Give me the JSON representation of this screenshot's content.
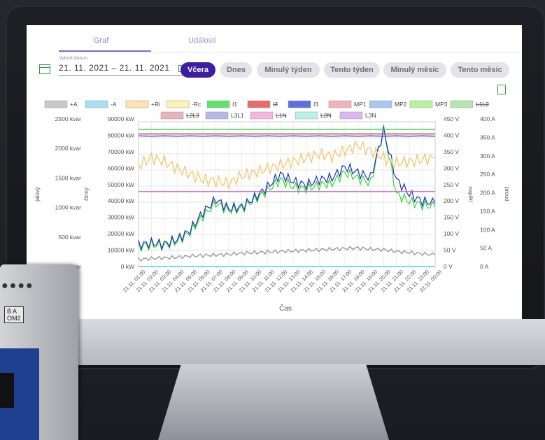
{
  "tabs": [
    {
      "label": "Graf",
      "active": true
    },
    {
      "label": "Události",
      "active": false
    }
  ],
  "date": {
    "label": "Vybrat datum",
    "value": "21. 11. 2021 – 21. 11. 2021"
  },
  "buttons": [
    {
      "label": "Včera",
      "active": true
    },
    {
      "label": "Dnes",
      "active": false
    },
    {
      "label": "Minulý týden",
      "active": false
    },
    {
      "label": "Tento týden",
      "active": false
    },
    {
      "label": "Minulý měsíc",
      "active": false
    },
    {
      "label": "Tento měsíc",
      "active": false
    }
  ],
  "meter": {
    "label_text": "B A",
    "label_sub": "OM2"
  },
  "colors": {
    "accent": "#3b1fa0",
    "tab": "#8a7fd0",
    "green_icon": "#2e9a46"
  },
  "chart_data": {
    "type": "line",
    "xlabel": "Čas",
    "x": [
      "21.11. 01:00",
      "21.11. 02:00",
      "21.11. 03:00",
      "21.11. 04:00",
      "21.11. 05:00",
      "21.11. 06:00",
      "21.11. 07:00",
      "21.11. 08:00",
      "21.11. 09:00",
      "21.11. 10:00",
      "21.11. 11:00",
      "21.11. 12:00",
      "21.11. 13:00",
      "21.11. 14:00",
      "21.11. 15:00",
      "21.11. 16:00",
      "21.11. 17:00",
      "21.11. 18:00",
      "21.11. 19:00",
      "21.11. 20:00",
      "21.11. 21:00",
      "21.11. 22:00",
      "21.11. 23:00",
      "22.11. 00:00"
    ],
    "axes": [
      {
        "label": "jalový",
        "ticks": [
          "0 kvar",
          "500 kvar",
          "1000 kvar",
          "1500 kvar",
          "2000 kvar",
          "2500 kvar"
        ],
        "range": [
          0,
          2500
        ],
        "unit": "kvar"
      },
      {
        "label": "činný",
        "ticks": [
          "0 kW",
          "10000 kW",
          "20000 kW",
          "30000 kW",
          "40000 kW",
          "50000 kW",
          "60000 kW",
          "70000 kW",
          "80000 kW",
          "90000 kW"
        ],
        "range": [
          0,
          90000
        ],
        "unit": "kW"
      },
      {
        "label": "napětí",
        "ticks": [
          "0 V",
          "50 V",
          "100 V",
          "150 V",
          "200 V",
          "250 V",
          "300 V",
          "350 V",
          "400 V",
          "450 V"
        ],
        "range": [
          0,
          450
        ],
        "unit": "V"
      },
      {
        "label": "proud",
        "ticks": [
          "0 A",
          "50 A",
          "100 A",
          "150 A",
          "200 A",
          "250 A",
          "300 A",
          "350 A",
          "400 A"
        ],
        "range": [
          0,
          400
        ],
        "unit": "A"
      }
    ],
    "legend": [
      {
        "name": "+A",
        "color": "#c8c8c8",
        "struck": false
      },
      {
        "name": "-A",
        "color": "#a8dff5",
        "struck": false
      },
      {
        "name": "+Ri",
        "color": "#fde2b0",
        "struck": false
      },
      {
        "name": "-Rc",
        "color": "#fbf3b4",
        "struck": false
      },
      {
        "name": "I1",
        "color": "#5ee36a",
        "struck": false
      },
      {
        "name": "I2",
        "color": "#e86b6b",
        "struck": true
      },
      {
        "name": "I3",
        "color": "#5d6fe0",
        "struck": false
      },
      {
        "name": "MP1",
        "color": "#f4b1b8",
        "struck": false
      },
      {
        "name": "MP2",
        "color": "#a9c7f3",
        "struck": false
      },
      {
        "name": "MP3",
        "color": "#b8f29d",
        "struck": false
      },
      {
        "name": "L1L2",
        "color": "#b6e6b0",
        "struck": true
      },
      {
        "name": "L2L3",
        "color": "#e6b3b8",
        "struck": true
      },
      {
        "name": "L3L1",
        "color": "#b6b8e6",
        "struck": false
      },
      {
        "name": "L1N",
        "color": "#f4b6dc",
        "struck": true
      },
      {
        "name": "L2N",
        "color": "#b8f0ea",
        "struck": true
      },
      {
        "name": "L3N",
        "color": "#dcb6f0",
        "struck": false
      }
    ],
    "series": [
      {
        "name": "I1",
        "axis": "proud",
        "color": "#2fdc2f",
        "values": [
          55,
          60,
          58,
          70,
          95,
          140,
          175,
          155,
          160,
          185,
          210,
          240,
          220,
          215,
          225,
          230,
          260,
          245,
          230,
          380,
          200,
          180,
          170,
          165
        ]
      },
      {
        "name": "I3",
        "axis": "proud",
        "color": "#1f2ec8",
        "values": [
          60,
          65,
          62,
          75,
          100,
          150,
          185,
          160,
          165,
          190,
          220,
          255,
          235,
          225,
          240,
          245,
          275,
          260,
          245,
          375,
          240,
          200,
          180,
          175
        ]
      },
      {
        "name": "+Ri",
        "axis": "proud",
        "color": "#f6c877",
        "values": [
          280,
          300,
          290,
          270,
          255,
          240,
          235,
          230,
          250,
          260,
          270,
          280,
          290,
          300,
          310,
          305,
          320,
          335,
          320,
          300,
          285,
          290,
          295,
          300
        ]
      },
      {
        "name": "+A",
        "axis": "jalový",
        "color": "#9a9a9a",
        "values": [
          120,
          140,
          150,
          160,
          180,
          190,
          200,
          210,
          230,
          240,
          250,
          260,
          270,
          280,
          290,
          300,
          310,
          320,
          300,
          290,
          260,
          240,
          220,
          200
        ]
      },
      {
        "name": "MP1",
        "axis": "napětí",
        "color": "#e03838",
        "values": [
          412,
          412,
          412,
          412,
          412,
          412,
          412,
          412,
          412,
          412,
          412,
          412,
          412,
          412,
          412,
          412,
          412,
          412,
          412,
          412,
          412,
          412,
          412,
          412
        ]
      },
      {
        "name": "MP2",
        "axis": "napětí",
        "color": "#3557d8",
        "values": [
          406,
          405,
          406,
          405,
          406,
          405,
          406,
          405,
          406,
          405,
          406,
          405,
          406,
          405,
          406,
          405,
          406,
          405,
          406,
          405,
          406,
          405,
          406,
          405
        ]
      },
      {
        "name": "MP3",
        "axis": "napětí",
        "color": "#3ee04a",
        "values": [
          426,
          426,
          426,
          426,
          426,
          426,
          426,
          426,
          426,
          426,
          426,
          426,
          426,
          426,
          426,
          426,
          426,
          426,
          426,
          426,
          426,
          426,
          426,
          426
        ]
      },
      {
        "name": "L3N",
        "axis": "napětí",
        "color": "#d35ad8",
        "values": [
          233,
          233,
          233,
          233,
          233,
          233,
          233,
          233,
          233,
          233,
          233,
          233,
          233,
          233,
          233,
          233,
          233,
          233,
          233,
          233,
          233,
          233,
          233,
          233
        ]
      },
      {
        "name": "-A",
        "axis": "napětí",
        "color": "#58c8f0",
        "values": [
          0,
          0,
          0,
          0,
          0,
          0,
          0,
          0,
          0,
          0,
          0,
          0,
          0,
          0,
          0,
          0,
          0,
          0,
          0,
          0,
          0,
          0,
          0,
          0
        ]
      }
    ]
  }
}
